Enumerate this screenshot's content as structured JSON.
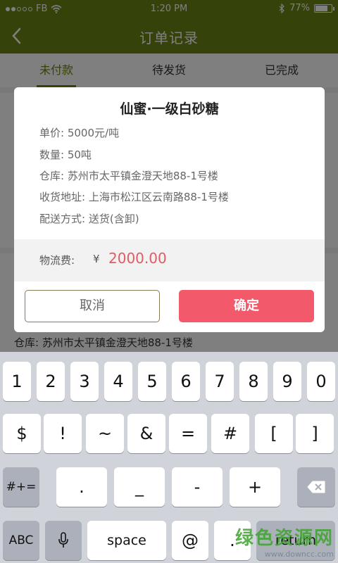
{
  "status": {
    "carrier": "FB",
    "time": "1:20 PM",
    "battery": "77%",
    "battery_level": 0.77
  },
  "nav": {
    "title": "订单记录"
  },
  "tabs": [
    "未付款",
    "待发货",
    "已完成"
  ],
  "background": {
    "warehouse_row": "仓库:  苏州市太平镇金澄天地88-1号楼"
  },
  "dialog": {
    "title": "仙蜜·一级白砂糖",
    "rows": [
      {
        "label": "单价:",
        "value": "5000元/吨"
      },
      {
        "label": "数量:",
        "value": "50吨"
      },
      {
        "label": "仓库:",
        "value": "苏州市太平镇金澄天地88-1号楼"
      },
      {
        "label": "收货地址:",
        "value": "上海市松江区云南路88-1号楼"
      },
      {
        "label": "配送方式:",
        "value": "送货(含卸)"
      }
    ],
    "fee_label": "物流费:",
    "currency": "¥",
    "fee_value": "2000.00",
    "cancel": "取消",
    "confirm": "确定"
  },
  "keyboard": {
    "row1": [
      "1",
      "2",
      "3",
      "4",
      "5",
      "6",
      "7",
      "8",
      "9",
      "0"
    ],
    "row2": [
      "$",
      "!",
      "~",
      "&",
      "=",
      "#",
      "[",
      "]"
    ],
    "row3": [
      "#+=",
      ".",
      "_",
      "-",
      "+"
    ],
    "row4": [
      "ABC",
      "space",
      "@",
      ".",
      "return"
    ]
  },
  "watermark": {
    "main": "绿色资源网",
    "url": "www.downcc.com"
  }
}
